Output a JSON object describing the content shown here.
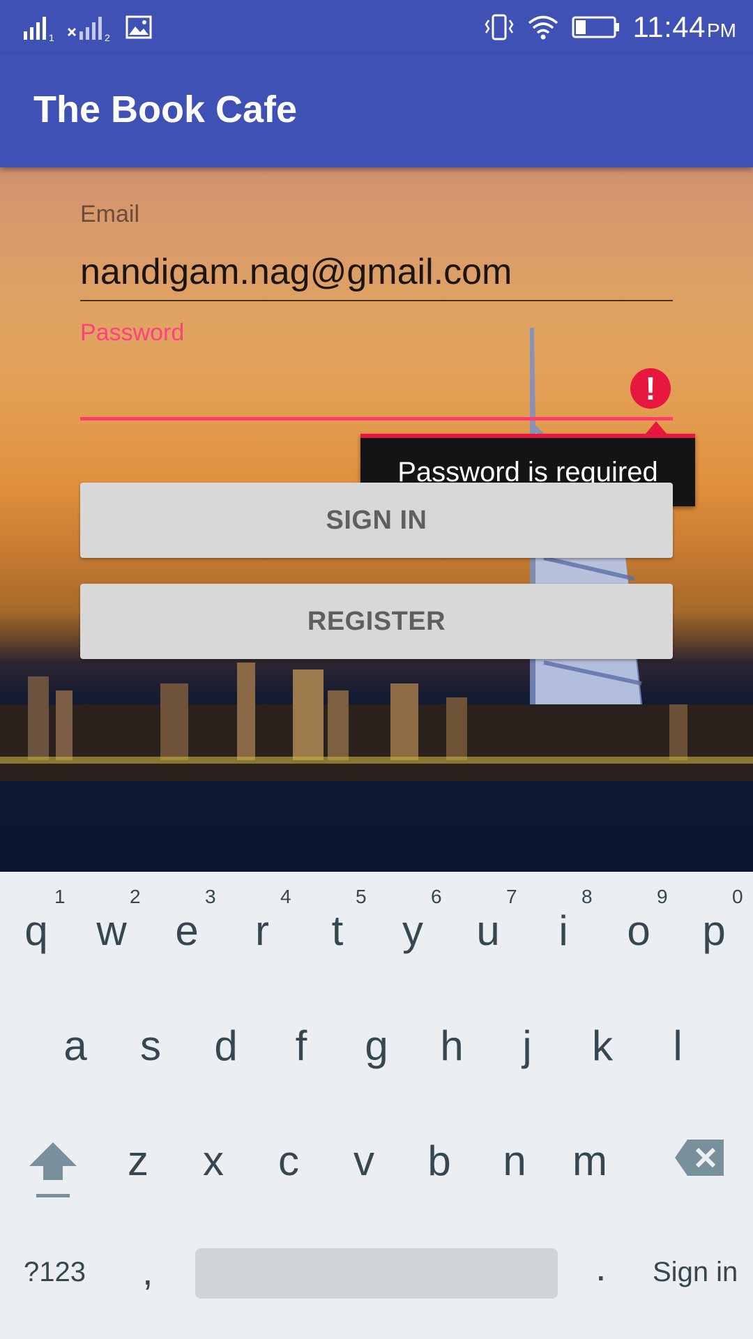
{
  "status_bar": {
    "time": "11:44",
    "ampm": "PM",
    "sim1_label": "1",
    "sim2_label": "2"
  },
  "app_bar": {
    "title": "The Book Cafe"
  },
  "form": {
    "email_label": "Email",
    "email_value": "nandigam.nag@gmail.com",
    "password_label": "Password",
    "password_value": "",
    "error_message": "Password is required",
    "sign_in_label": "SIGN IN",
    "register_label": "REGISTER"
  },
  "keyboard": {
    "row1_letters": [
      "q",
      "w",
      "e",
      "r",
      "t",
      "y",
      "u",
      "i",
      "o",
      "p"
    ],
    "row1_hints": [
      "1",
      "2",
      "3",
      "4",
      "5",
      "6",
      "7",
      "8",
      "9",
      "0"
    ],
    "row2_letters": [
      "a",
      "s",
      "d",
      "f",
      "g",
      "h",
      "j",
      "k",
      "l"
    ],
    "row3_letters": [
      "z",
      "x",
      "c",
      "v",
      "b",
      "n",
      "m"
    ],
    "symbols_label": "?123",
    "comma_label": ",",
    "period_label": ".",
    "action_label": "Sign in"
  },
  "colors": {
    "primary": "#3f51b5",
    "accent": "#ff4081",
    "error": "#e8173f"
  }
}
